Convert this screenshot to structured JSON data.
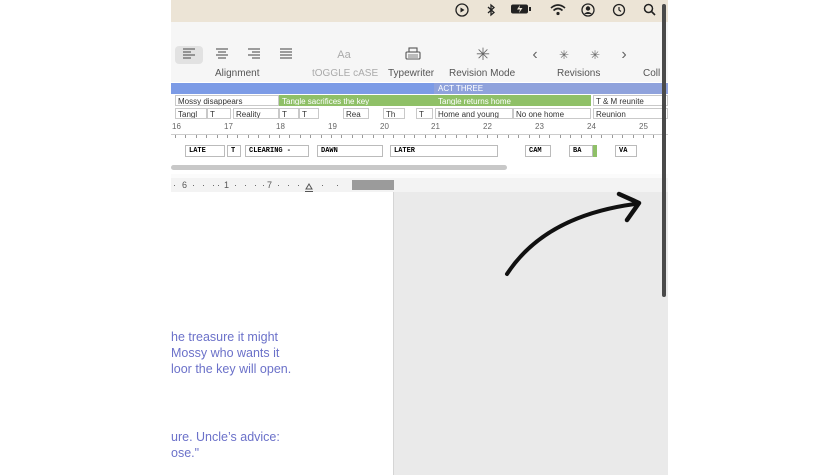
{
  "menubar": {
    "icons": [
      "play-circle-icon",
      "bluetooth-icon",
      "battery-charging-icon",
      "wifi-icon",
      "user-circle-icon",
      "time-machine-icon",
      "search-icon"
    ]
  },
  "toolbar": {
    "alignment_label": "Alignment",
    "toggle_case_label": "tOGGLE cASE",
    "toggle_case_glyph": "Aa",
    "typewriter_label": "Typewriter",
    "revision_mode_label": "Revision Mode",
    "revisions_label": "Revisions",
    "collections_label": "Coll"
  },
  "timeline": {
    "act_label": "ACT THREE",
    "act_color": "#8fa2dc",
    "prev_act_color": "#7c9be6",
    "row1": [
      {
        "text": "Mossy disappears",
        "green": false
      },
      {
        "text": "Tangle sacrifices the key",
        "green": true
      },
      {
        "text": "Tangle returns home",
        "green": true
      },
      {
        "text": "T & M reunite",
        "green": false
      }
    ],
    "row2": [
      "Tangl",
      "T",
      "Reality",
      "T",
      "T",
      "Rea",
      "Th",
      "T",
      "Home and young",
      "No one home",
      "Reunion"
    ],
    "ruler_numbers": [
      "16",
      "17",
      "18",
      "19",
      "20",
      "21",
      "22",
      "23",
      "24",
      "25"
    ],
    "scenes": [
      "LATE",
      "T",
      "CLEARING -",
      "DAWN",
      "LATER",
      "CAM",
      "BA",
      "VA"
    ]
  },
  "ruler": {
    "marks": [
      "·",
      "6",
      "·",
      "·",
      "·",
      "·",
      "1",
      "·",
      "·",
      "·",
      "·",
      "7",
      "·",
      "·",
      "·",
      "·",
      "·"
    ]
  },
  "document": {
    "lines": [
      "he treasure it might",
      " Mossy who wants it",
      "loor the key will open.",
      "",
      "",
      "ure. Uncle’s advice:",
      "ose.\""
    ],
    "text_color": "#6b71c9"
  }
}
